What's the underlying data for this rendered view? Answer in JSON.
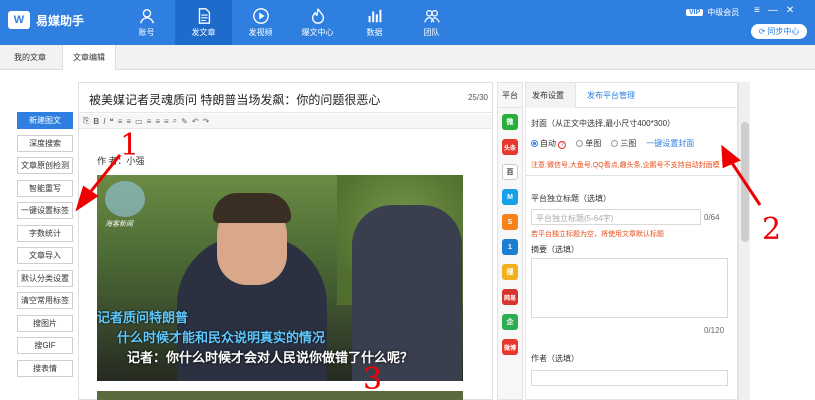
{
  "app": {
    "logo_glyph": "W",
    "name": "易媒助手"
  },
  "nav": [
    {
      "label": "账号",
      "icon": "user-icon"
    },
    {
      "label": "发文章",
      "icon": "document-icon",
      "active": true
    },
    {
      "label": "发视频",
      "icon": "play-icon"
    },
    {
      "label": "爆文中心",
      "icon": "flame-icon"
    },
    {
      "label": "数据",
      "icon": "bar-chart-icon"
    },
    {
      "label": "团队",
      "icon": "team-icon"
    }
  ],
  "account": {
    "vip_badge": "VIP",
    "level": "中级会员",
    "sync_label": "同步中心"
  },
  "tabs": [
    {
      "label": "我的文章"
    },
    {
      "label": "文章编辑",
      "active": true
    }
  ],
  "tools": [
    "新建图文",
    "深度搜索",
    "文章原创检测",
    "智能重写",
    "一键设置标签",
    "字数统计",
    "文章导入",
    "默认分类设置",
    "清空常用标签",
    "搜图片",
    "搜GIF",
    "搜表情"
  ],
  "editor": {
    "title": "被美媒记者灵魂质问 特朗普当场发飙：你的问题很恶心",
    "title_count": "25/30",
    "author_line": "作 者：小强",
    "image_logo_text": "海客新闻",
    "caption_line1": "记者质问特朗普",
    "caption_line2": "什么时候才能和民众说明真实的情况",
    "caption_line3": "记者：你什么时候才会对人民说你做错了什么呢？",
    "toolbar_glyphs": [
      "⎘",
      "B",
      "I",
      "❝",
      "≡",
      "≡",
      "▭",
      "≡",
      "≡",
      "≡",
      "⌕",
      "✎",
      "↶",
      "↷"
    ]
  },
  "platforms": {
    "label": "平台",
    "items": [
      {
        "name": "wechat-icon",
        "text": "微",
        "color": "#2aae3b"
      },
      {
        "name": "toutiao-icon",
        "text": "头条",
        "color": "#e8372c"
      },
      {
        "name": "baijia-icon",
        "text": "百",
        "color": "#ffffff"
      },
      {
        "name": "dayu-icon",
        "text": "M",
        "color": "#1aa0e6"
      },
      {
        "name": "sohu-icon",
        "text": "S",
        "color": "#f7821b"
      },
      {
        "name": "yidian-icon",
        "text": "1",
        "color": "#1b7fd1"
      },
      {
        "name": "souhu-yellow-icon",
        "text": "搜",
        "color": "#f2b01e"
      },
      {
        "name": "wangyi-icon",
        "text": "网易",
        "color": "#d6342c"
      },
      {
        "name": "qq-green-icon",
        "text": "企",
        "color": "#2dad52"
      },
      {
        "name": "weibo-icon",
        "text": "微博",
        "color": "#e8372c"
      }
    ]
  },
  "settings": {
    "tab_publish": "发布设置",
    "tab_manage": "发布平台管理",
    "cover_label": "封面（从正文中选择,最小尺寸400*300）",
    "cover_auto": "自动",
    "cover_single": "单图",
    "cover_triple": "三图",
    "cover_onekey": "一键设置封面",
    "notice": "注意:微信号,大鱼号,QQ看点,趣头条,企鹅号不支持自动封面模",
    "title_label": "平台独立标题（选填）",
    "title_placeholder": "平台独立标题(5-64字)",
    "title_count": "0/64",
    "title_hint": "若平台独立标题为空，将使用文章默认标题",
    "summary_label": "摘要（选填）",
    "summary_count": "0/120",
    "author_label": "作者（选填）"
  },
  "annotations": [
    "1",
    "2",
    "3"
  ]
}
